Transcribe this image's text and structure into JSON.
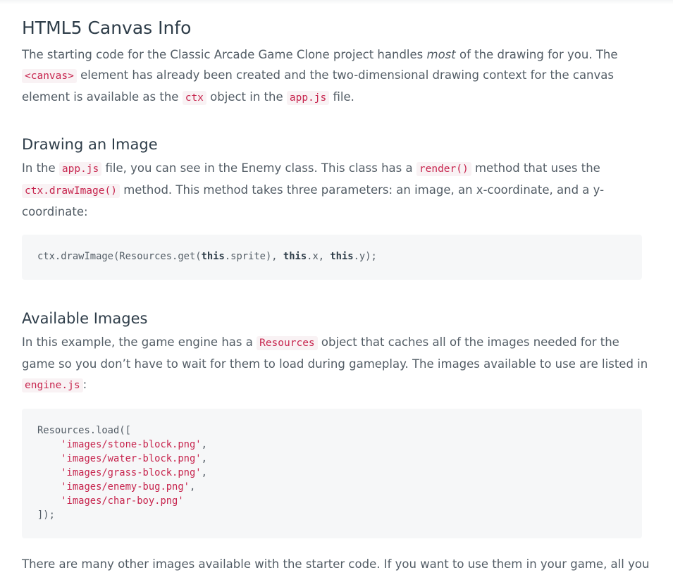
{
  "section_title": "HTML5 Canvas Info",
  "intro": {
    "line1_a": "The starting code for the Classic Arcade Game Clone project handles ",
    "line1_em": "most",
    "line1_b": " of the drawing for you. The",
    "code_canvas": "<canvas>",
    "line2_b": " element has already been created and the two-dimensional drawing context for the canvas",
    "line3_a": "element is available as the ",
    "code_ctx": "ctx",
    "line3_b": " object in the ",
    "code_appjs": "app.js",
    "line3_c": " file."
  },
  "drawing": {
    "heading": "Drawing an Image",
    "line1_a": "In the ",
    "code_appjs": "app.js",
    "line1_b": " file, you can see in the Enemy class. This class has a ",
    "code_render": "render()",
    "line1_c": " method that uses the",
    "code_drawimage": "ctx.drawImage()",
    "line2_b": " method. This method takes three parameters: an image, an x-coordinate, and a y-",
    "line3": "coordinate:",
    "code": {
      "p1": "ctx.drawImage(Resources.get(",
      "kw1": "this",
      "p2": ".sprite), ",
      "kw2": "this",
      "p3": ".x, ",
      "kw3": "this",
      "p4": ".y);"
    }
  },
  "available": {
    "heading": "Available Images",
    "line1_a": "In this example, the game engine has a ",
    "code_resources": "Resources",
    "line1_b": " object that caches all of the images needed for the",
    "line2": "game so you don’t have to wait for them to load during gameplay. The images available to use are listed in",
    "code_enginejs": "engine.js",
    "line3_b": ":",
    "code": {
      "open": "Resources.load([",
      "indent": "    ",
      "items": [
        "'images/stone-block.png'",
        "'images/water-block.png'",
        "'images/grass-block.png'",
        "'images/enemy-bug.png'",
        "'images/char-boy.png'"
      ],
      "item_suffixes": [
        ",",
        ",",
        ",",
        ",",
        ""
      ],
      "close": "]);"
    }
  },
  "closing": {
    "line1": "There are many other images available with the starter code. If you want to use them in your game, all you"
  }
}
